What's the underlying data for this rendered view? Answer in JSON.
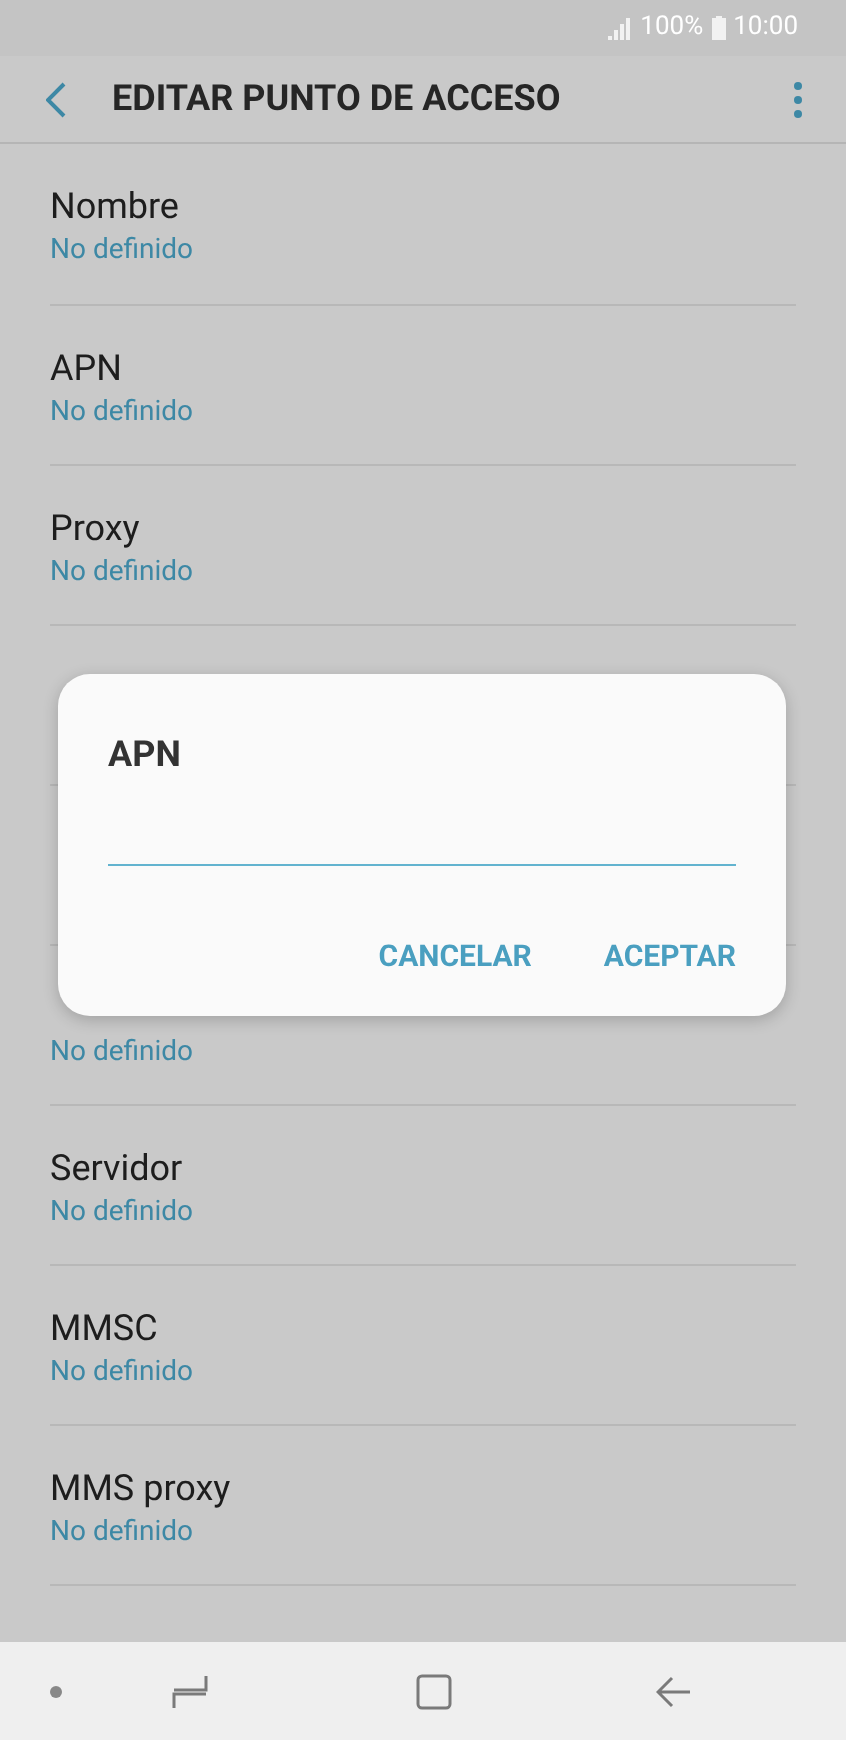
{
  "status_bar": {
    "battery": "100%",
    "time": "10:00"
  },
  "header": {
    "title": "EDITAR PUNTO DE ACCESO"
  },
  "settings": [
    {
      "kind": "setting",
      "title": "Nombre",
      "value": "No definido"
    },
    {
      "kind": "setting",
      "title": "APN",
      "value": "No definido"
    },
    {
      "kind": "setting",
      "title": "Proxy",
      "value": "No definido"
    },
    {
      "kind": "covered"
    },
    {
      "kind": "covered"
    },
    {
      "kind": "setting",
      "value": "No definido"
    },
    {
      "kind": "setting",
      "title": "Servidor",
      "value": "No definido"
    },
    {
      "kind": "setting",
      "title": "MMSC",
      "value": "No definido"
    },
    {
      "kind": "setting",
      "title": "MMS proxy",
      "value": "No definido"
    },
    {
      "kind": "covered"
    }
  ],
  "dialog": {
    "title": "APN",
    "buttons": [
      "CANCELAR",
      "ACEPTAR"
    ]
  }
}
